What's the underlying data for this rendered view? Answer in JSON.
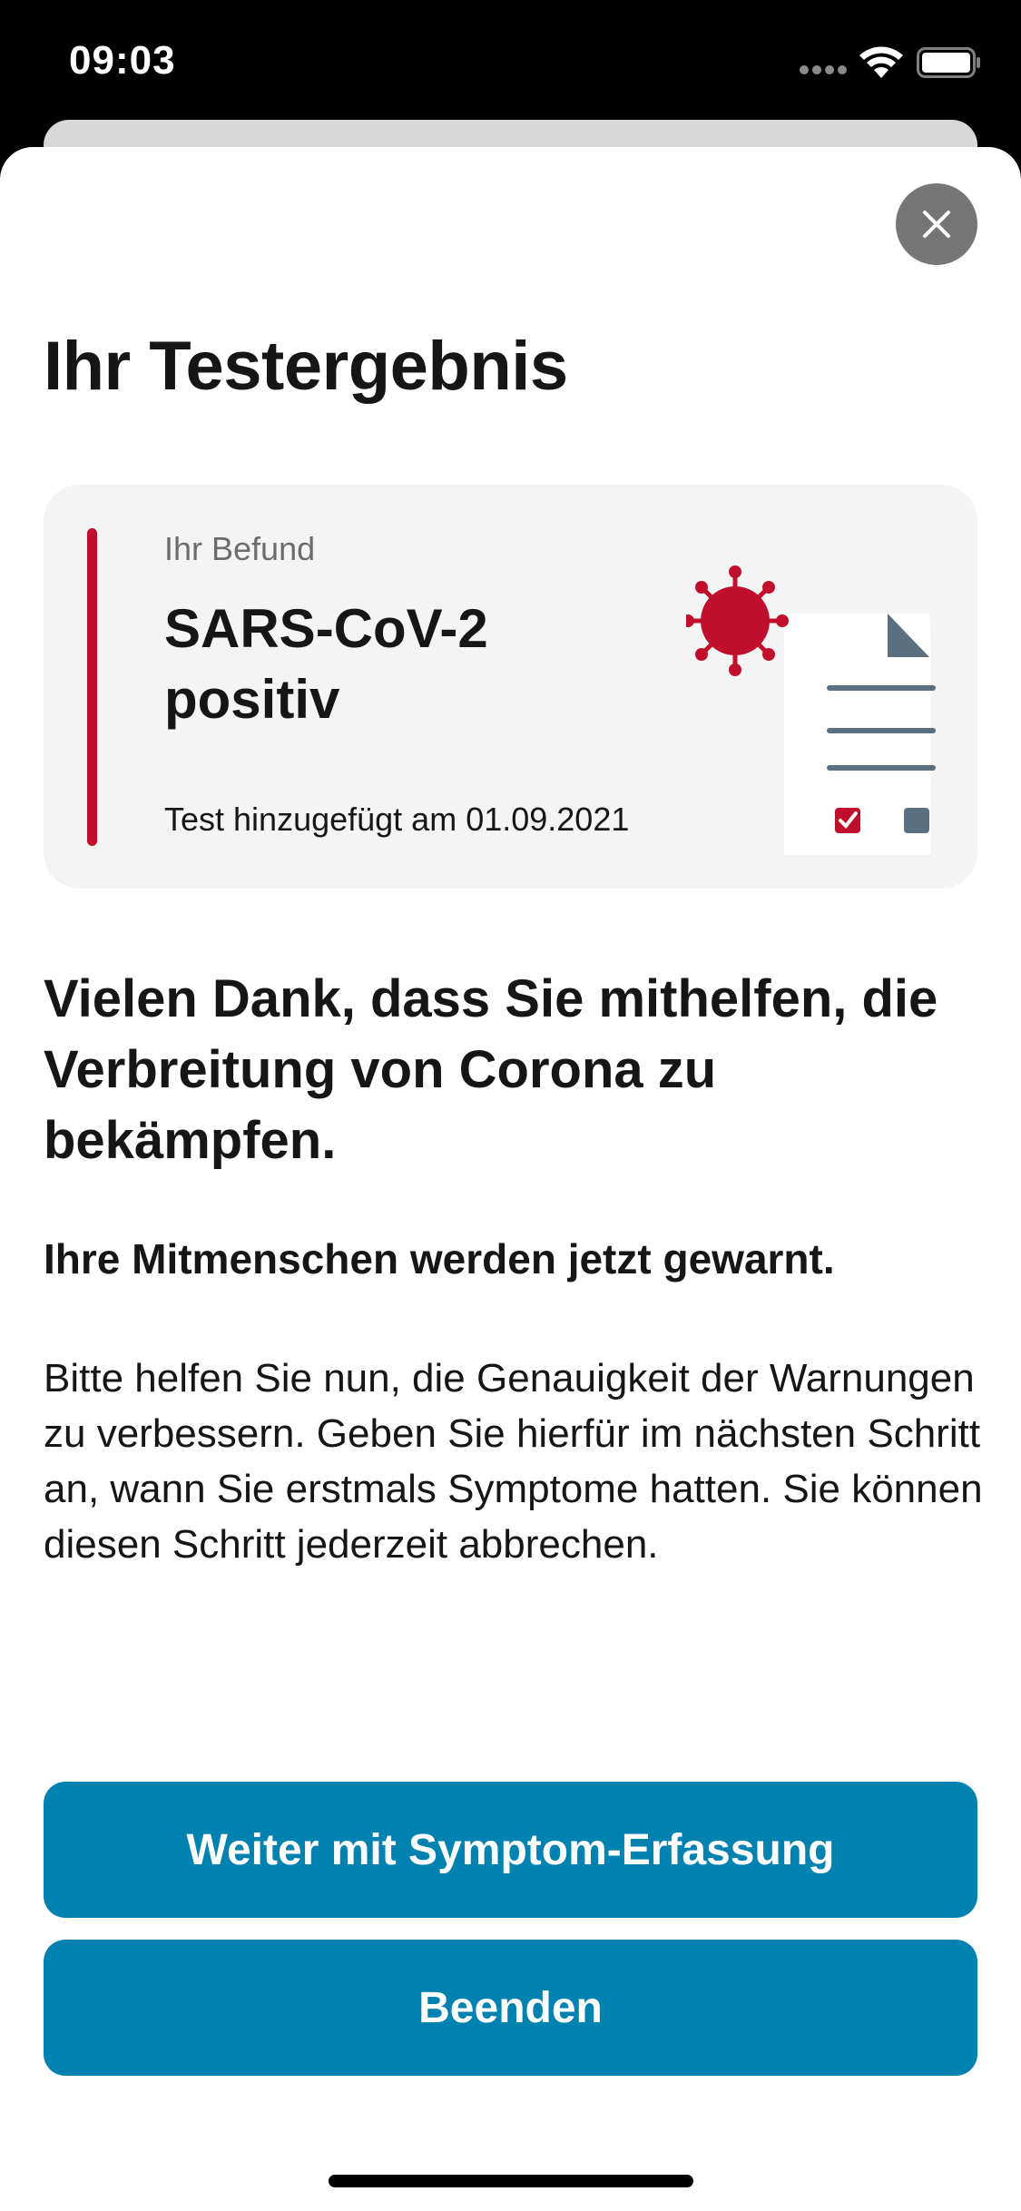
{
  "status_bar": {
    "time": "09:03"
  },
  "header": {
    "title": "Ihr Testergebnis"
  },
  "result_card": {
    "label": "Ihr Befund",
    "value": "SARS-CoV-2 positiv",
    "date_text": "Test hinzugefügt am 01.09.2021",
    "accent_color": "#c00f2d"
  },
  "content": {
    "heading": "Vielen Dank, dass Sie mithelfen, die Verbreitung von Corona zu bekämpfen.",
    "subheading": "Ihre Mitmenschen werden jetzt gewarnt.",
    "body": "Bitte helfen Sie nun, die Genauigkeit der Warnungen zu verbessern. Geben Sie hierfür im nächsten Schritt an, wann Sie erstmals Symptome hatten. Sie können diesen Schritt jederzeit abbrechen."
  },
  "buttons": {
    "continue_label": "Weiter mit Symptom-Erfassung",
    "end_label": "Beenden",
    "color": "#0082b1"
  },
  "icons": {
    "close": "close-icon",
    "wifi": "wifi-icon",
    "battery": "battery-icon",
    "signal": "signal-icon",
    "illustration": "test-result-document-icon"
  }
}
